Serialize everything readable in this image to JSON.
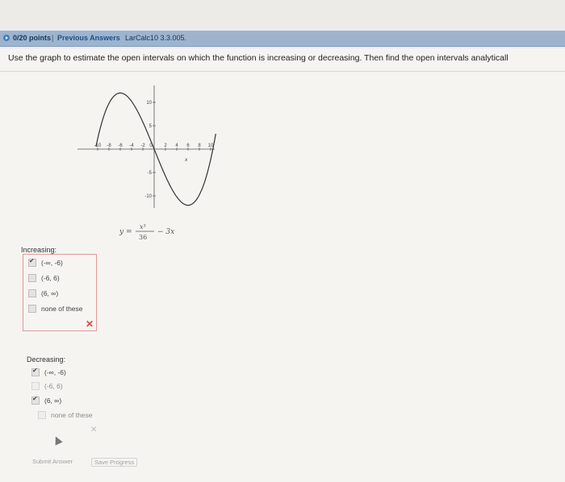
{
  "header": {
    "points": "0/20 points",
    "separator": "|",
    "previous_answers": "Previous Answers",
    "problem_code": "LarCalc10 3.3.005."
  },
  "question": {
    "text": "Use the graph to estimate the open intervals on which the function is increasing or decreasing. Then find the open intervals analyticall"
  },
  "graph": {
    "x_ticks": [
      "-10",
      "-8",
      "-6",
      "-4",
      "-2",
      "0",
      "2",
      "4",
      "6",
      "8",
      "10"
    ],
    "y_ticks": [
      "10",
      "5",
      "-5",
      "-10"
    ],
    "x_axis_label": "x",
    "equation": {
      "lhs": "y =",
      "numerator": "x³",
      "denominator": "36",
      "rest": "− 3x"
    }
  },
  "increasing": {
    "label": "Increasing:",
    "options": [
      {
        "text": "(-∞, -6)",
        "checked": true
      },
      {
        "text": "(-6, 6)",
        "checked": false
      },
      {
        "text": "(6, ∞)",
        "checked": false
      },
      {
        "text": "none of these",
        "checked": false
      }
    ],
    "result_mark": "✕"
  },
  "decreasing": {
    "label": "Decreasing:",
    "options": [
      {
        "text": "(-∞, -6)",
        "checked": true
      },
      {
        "text": "(-6, 6)",
        "checked": false
      },
      {
        "text": "(6, ∞)",
        "checked": true
      },
      {
        "text": "none of these",
        "checked": false
      }
    ],
    "result_mark": "✕"
  },
  "buttons": {
    "submit": "Submit Answer",
    "save": "Save Progress"
  },
  "colors": {
    "header_bar": "#9db4cf",
    "incorrect_mark": "#d24a4a",
    "incorrect_border": "#e09a9a"
  }
}
